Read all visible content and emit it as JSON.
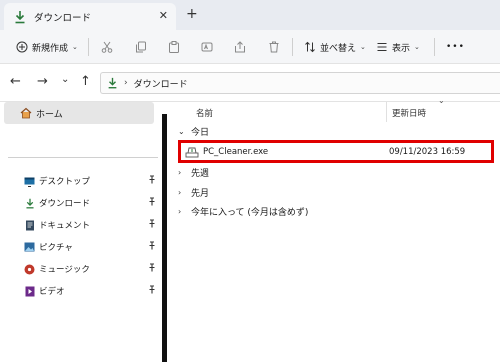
{
  "window": {
    "tab_title": "ダウンロード",
    "tab_close": "✕",
    "new_tab": "+"
  },
  "toolbar": {
    "new_label": "新規作成",
    "sort_label": "並べ替え",
    "view_label": "表示",
    "more_label": "•••",
    "chevron": "⌄"
  },
  "address": {
    "back": "←",
    "forward": "→",
    "recent": "⌄",
    "up": "↑",
    "separator": "›",
    "crumb": "ダウンロード"
  },
  "nav_pane": {
    "home_label": "ホーム",
    "quick_access": [
      {
        "label": "デスクトップ",
        "icon": "desktop-icon",
        "pin": "📌"
      },
      {
        "label": "ダウンロード",
        "icon": "download-icon",
        "pin": "📌"
      },
      {
        "label": "ドキュメント",
        "icon": "document-icon",
        "pin": "📌"
      },
      {
        "label": "ピクチャ",
        "icon": "pictures-icon",
        "pin": "📌"
      },
      {
        "label": "ミュージック",
        "icon": "music-icon",
        "pin": "📌"
      },
      {
        "label": "ビデオ",
        "icon": "video-icon",
        "pin": "📌"
      }
    ]
  },
  "file_list": {
    "col_name": "名前",
    "col_date": "更新日時",
    "sort_indicator": "⌄",
    "groups": [
      {
        "label": "今日",
        "arrow": "⌄"
      },
      {
        "label": "先週",
        "arrow": "›"
      },
      {
        "label": "先月",
        "arrow": "›"
      },
      {
        "label": "今年に入って (今月は含めず)",
        "arrow": "›"
      }
    ],
    "files": [
      {
        "name": "PC_Cleaner.exe",
        "date": "09/11/2023 16:59"
      }
    ]
  },
  "colors": {
    "highlight_border": "#e00000",
    "accent_green": "#2a7a3b"
  }
}
